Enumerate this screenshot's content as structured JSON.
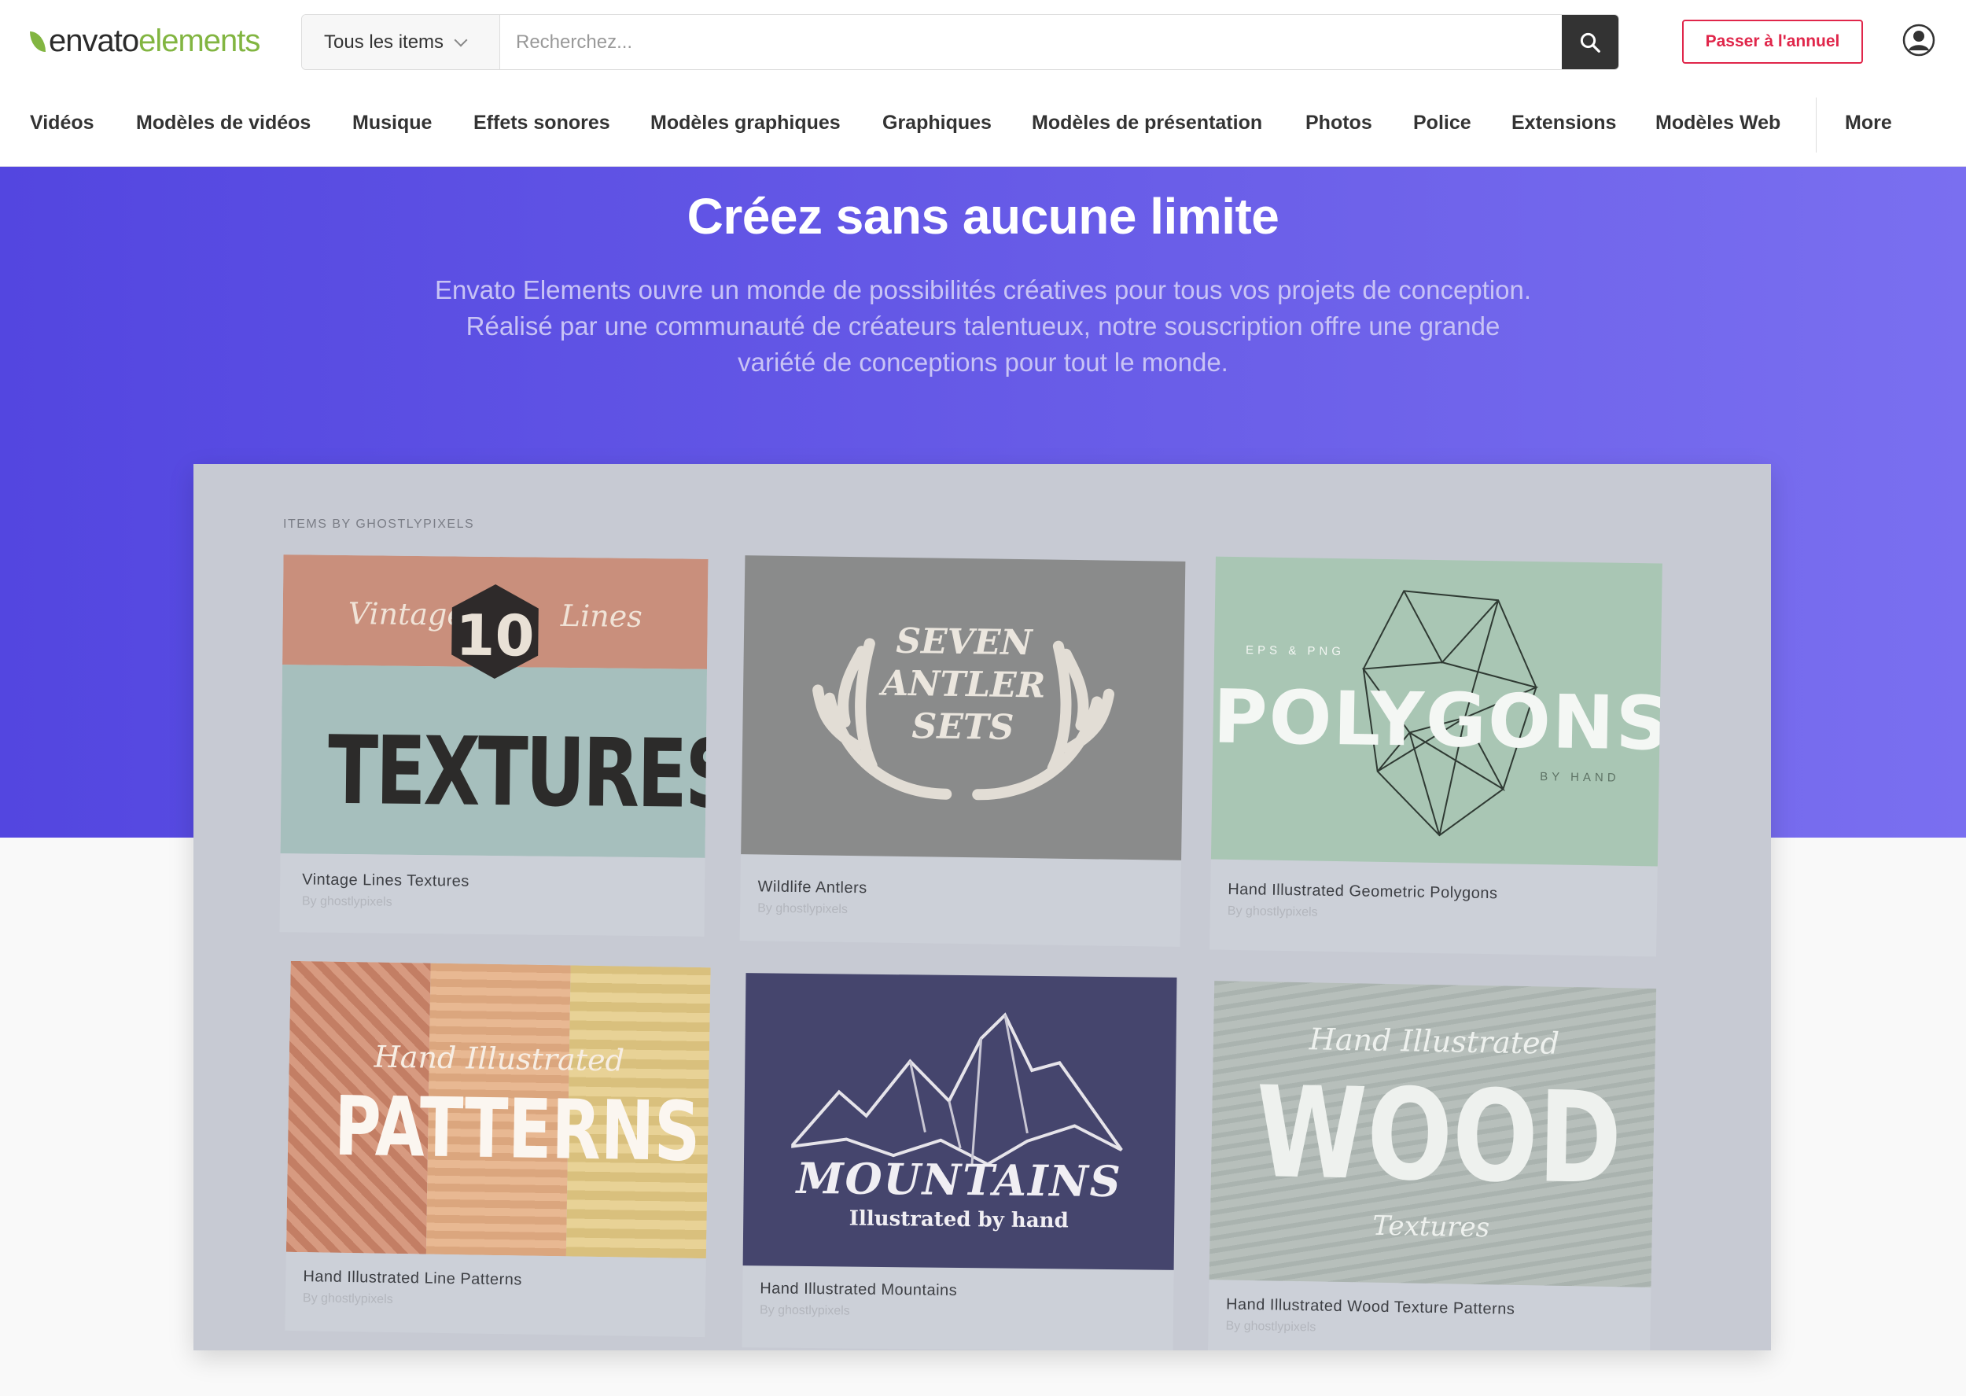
{
  "header": {
    "logo_part1": "envato",
    "logo_part2": "elements",
    "category_select": "Tous les items",
    "search_placeholder": "Recherchez...",
    "upgrade_label": "Passer à l'annuel",
    "icons": {
      "search": "search-icon",
      "account": "user-account-icon",
      "dropdown": "chevron-down-icon"
    },
    "colors": {
      "brand_green": "#82b541",
      "upgrade_red": "#e0264a"
    }
  },
  "nav": {
    "items": [
      "Vidéos",
      "Modèles de vidéos",
      "Musique",
      "Effets sonores",
      "Modèles graphiques",
      "Graphiques",
      "Modèles de présentation",
      "Photos",
      "Police",
      "Extensions",
      "Modèles Web"
    ],
    "more_label": "More"
  },
  "hero": {
    "title": "Créez sans aucune limite",
    "subtitle_line1": "Envato Elements ouvre un monde de possibilités créatives pour tous vos projets de conception.",
    "subtitle_line2": "Réalisé par une communauté de créateurs talentueux, notre souscription offre une grande",
    "subtitle_line3": "variété de conceptions pour tout le monde.",
    "colors": {
      "gradient_start": "#5346e0",
      "gradient_end": "#7a6ff0"
    }
  },
  "showcase": {
    "section_label": "ITEMS BY GHOSTLYPIXELS",
    "items": [
      {
        "title": "Vintage Lines Textures",
        "author": "By ghostlypixels",
        "art": {
          "line1": "Vintage",
          "number": "10",
          "line2": "Lines",
          "big": "TEXTURES"
        }
      },
      {
        "title": "Wildlife Antlers",
        "author": "By ghostlypixels",
        "art": {
          "line1": "SEVEN",
          "line2": "ANTLER",
          "line3": "SETS"
        }
      },
      {
        "title": "Hand Illustrated Geometric Polygons",
        "author": "By ghostlypixels",
        "art": {
          "small": "EPS & PNG",
          "big": "POLYGONS",
          "by": "BY HAND"
        }
      },
      {
        "title": "Hand Illustrated Line Patterns",
        "author": "By ghostlypixels",
        "art": {
          "script": "Hand Illustrated",
          "big": "PATTERNS"
        }
      },
      {
        "title": "Hand Illustrated Mountains",
        "author": "By ghostlypixels",
        "art": {
          "big": "MOUNTAINS",
          "sub": "Illustrated by hand"
        }
      },
      {
        "title": "Hand Illustrated Wood Texture Patterns",
        "author": "By ghostlypixels",
        "art": {
          "script": "Hand Illustrated",
          "big": "WOOD",
          "sub": "Textures"
        }
      }
    ]
  }
}
